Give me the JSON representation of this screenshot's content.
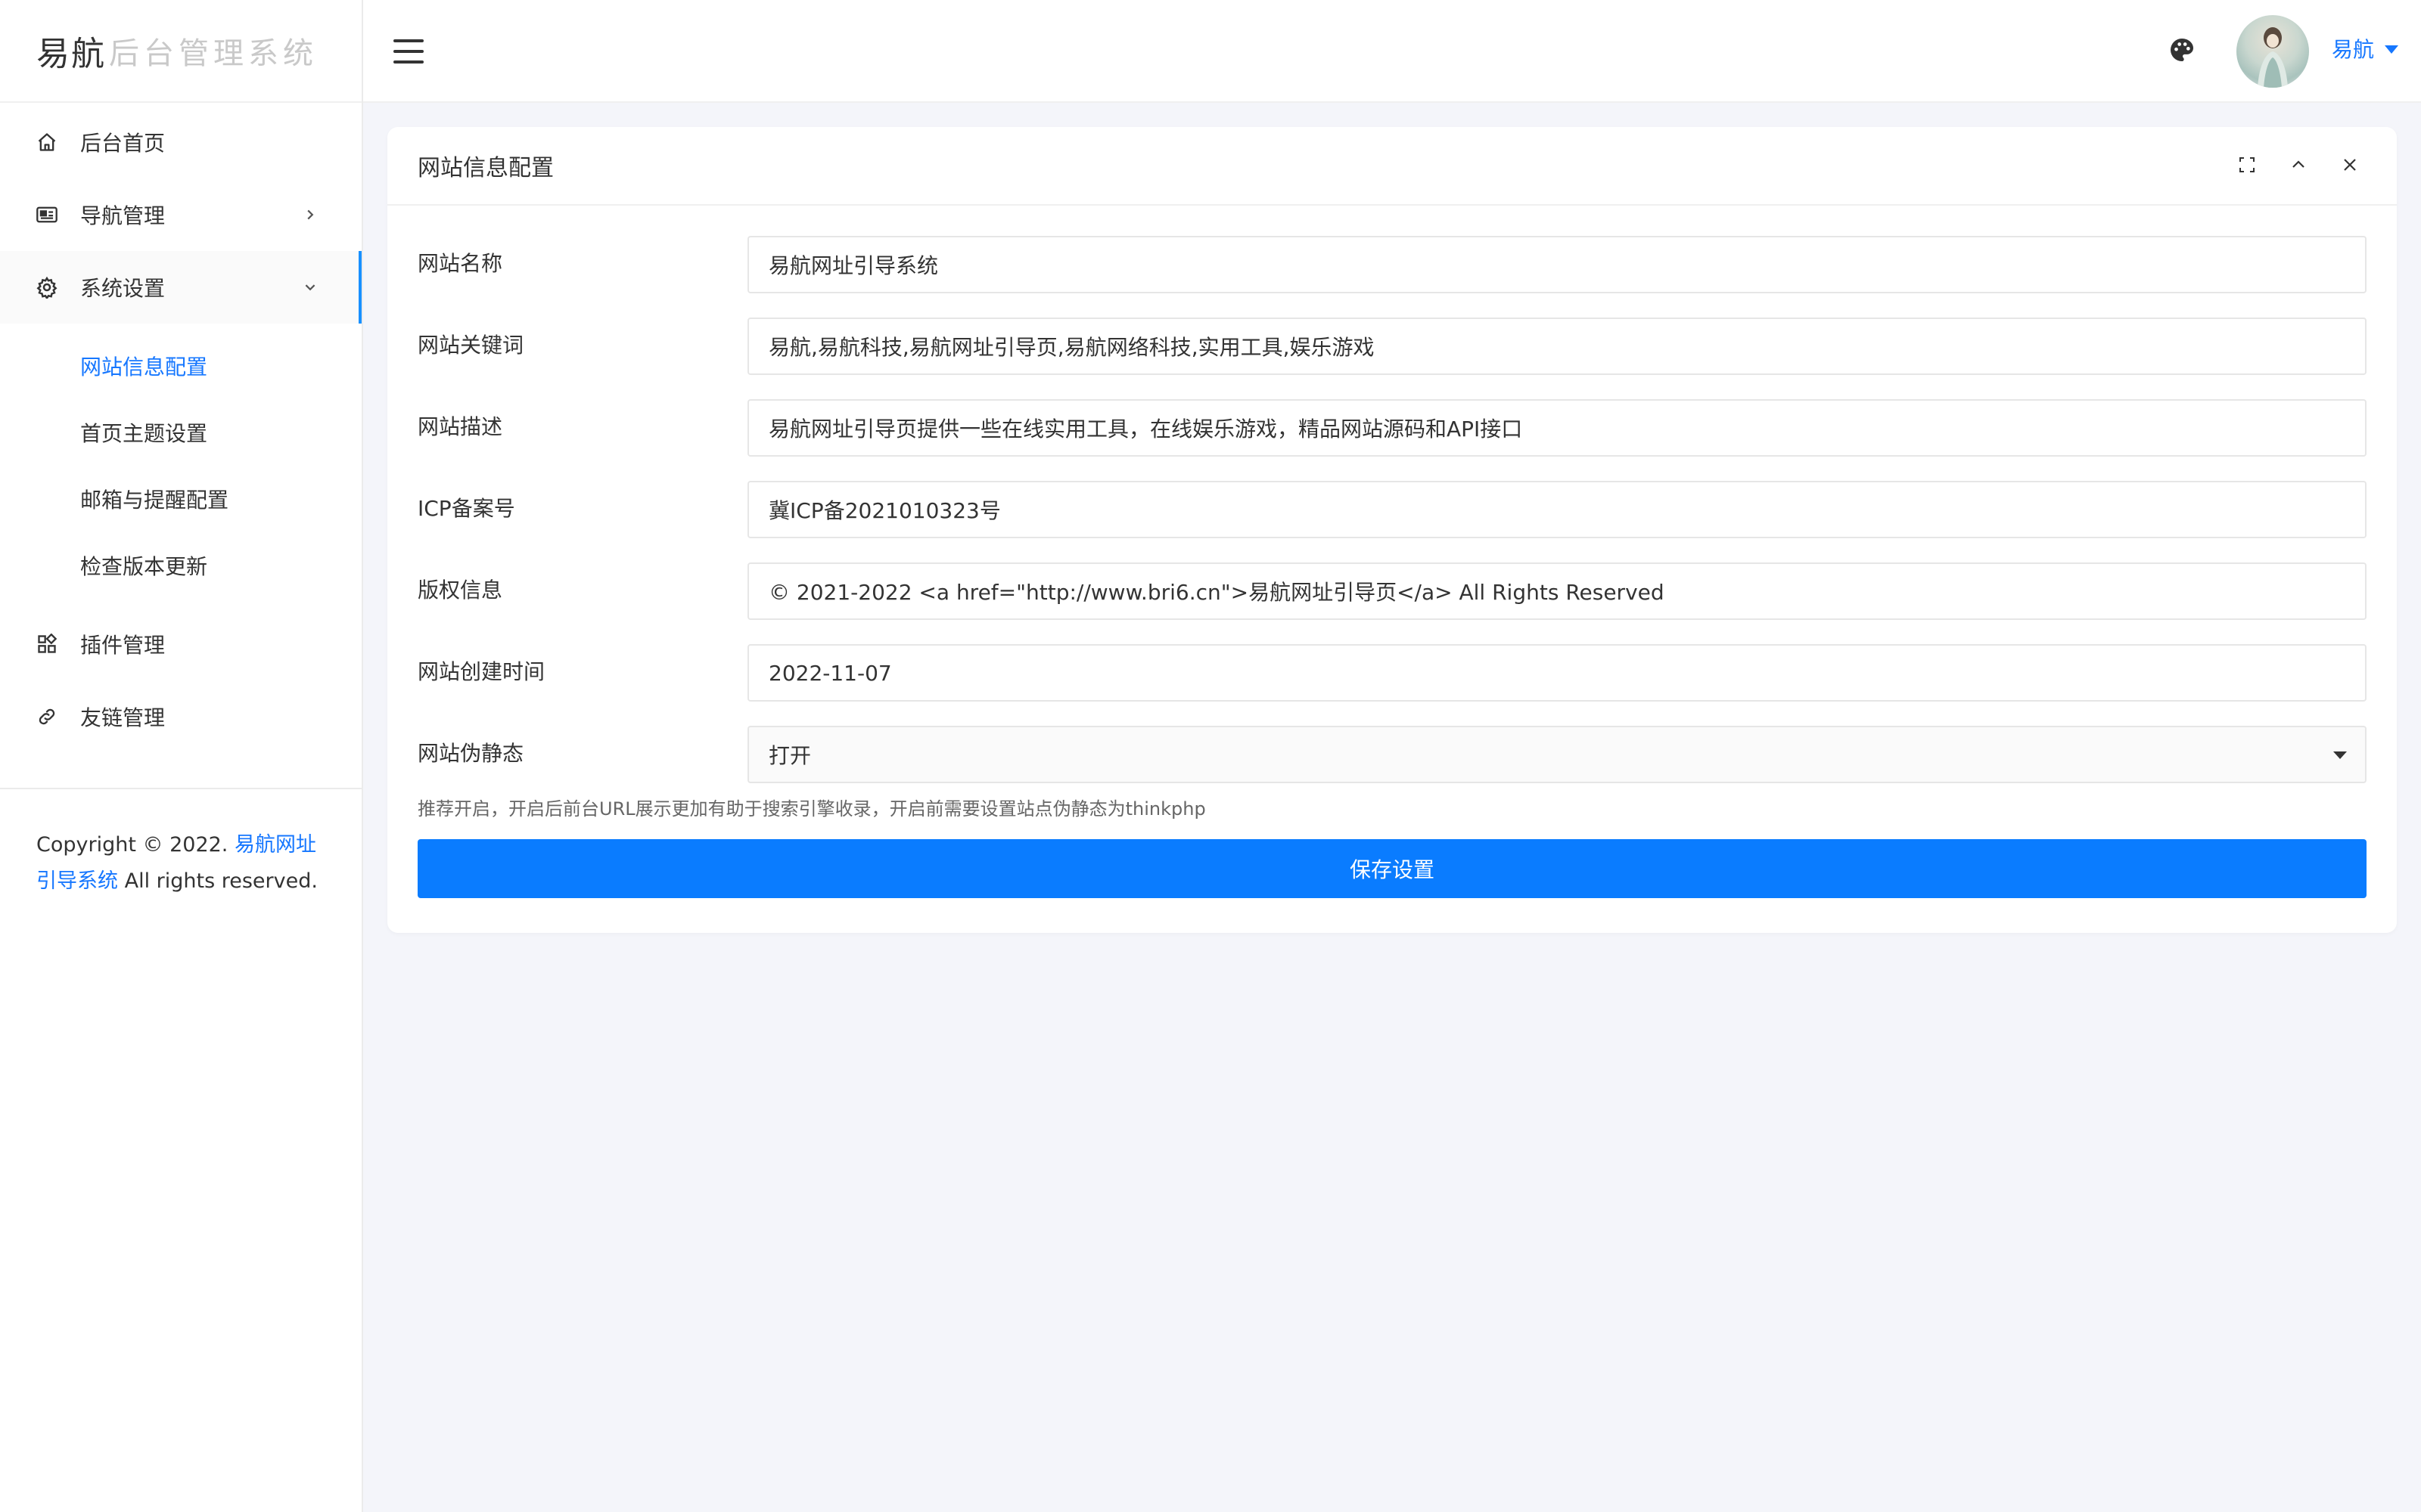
{
  "logo": {
    "main": "易航",
    "sub": "后台管理系统"
  },
  "sidebar": {
    "items": [
      {
        "label": "后台首页",
        "icon": "home-icon"
      },
      {
        "label": "导航管理",
        "icon": "newspaper-icon"
      },
      {
        "label": "系统设置",
        "icon": "gear-icon"
      },
      {
        "label": "插件管理",
        "icon": "apps-icon"
      },
      {
        "label": "友链管理",
        "icon": "link-icon"
      }
    ],
    "submenu": [
      {
        "label": "网站信息配置"
      },
      {
        "label": "首页主题设置"
      },
      {
        "label": "邮箱与提醒配置"
      },
      {
        "label": "检查版本更新"
      }
    ],
    "footer": {
      "prefix": "Copyright © 2022.",
      "link": "易航网址引导系统",
      "suffix": "All rights reserved."
    }
  },
  "header": {
    "user_name": "易航"
  },
  "card": {
    "title": "网站信息配置",
    "fields": [
      {
        "label": "网站名称",
        "value": "易航网址引导系统"
      },
      {
        "label": "网站关键词",
        "value": "易航,易航科技,易航网址引导页,易航网络科技,实用工具,娱乐游戏"
      },
      {
        "label": "网站描述",
        "value": "易航网址引导页提供一些在线实用工具，在线娱乐游戏，精品网站源码和API接口"
      },
      {
        "label": "ICP备案号",
        "value": "冀ICP备2021010323号"
      },
      {
        "label": "版权信息",
        "value": "© 2021-2022 <a href=\"http://www.bri6.cn\">易航网址引导页</a> All Rights Reserved"
      },
      {
        "label": "网站创建时间",
        "value": "2022-11-07"
      },
      {
        "label": "网站伪静态",
        "value": "打开"
      }
    ],
    "help": "推荐开启，开启后前台URL展示更加有助于搜索引擎收录，开启前需要设置站点伪静态为thinkphp",
    "save_label": "保存设置"
  },
  "colors": {
    "accent": "#0a7cff",
    "link": "#1677ff",
    "background": "#f4f5fa"
  }
}
